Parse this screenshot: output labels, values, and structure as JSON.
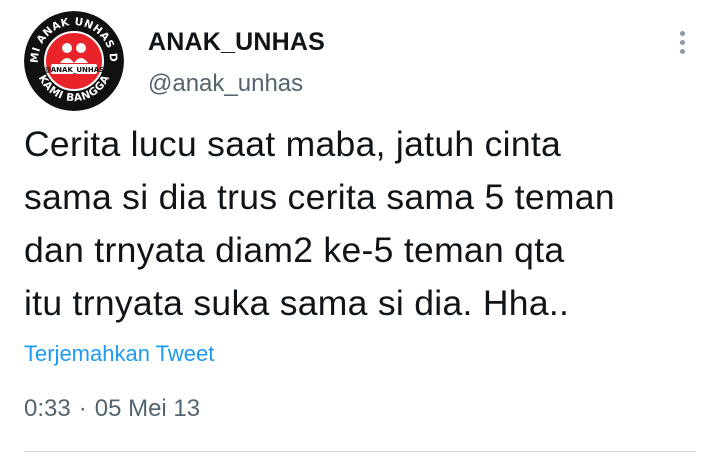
{
  "account": {
    "display_name": "ANAK_UNHAS",
    "handle": "@anak_unhas",
    "avatar_ring_text": "KAMI ANAK UNHAS DAN KAMI BANGGA",
    "avatar_badge_text": "@ANAK_UNHAS",
    "colors": {
      "avatar_ring": "#111111",
      "avatar_center": "#e8232a"
    }
  },
  "more_icon": "more-vertical-icon",
  "tweet": {
    "lines": [
      "Cerita lucu saat maba, jatuh cinta",
      "sama si dia trus cerita sama 5 teman",
      "dan trnyata diam2 ke-5 teman qta",
      "itu trnyata suka sama si dia. Hha.."
    ],
    "translate_label": "Terjemahkan Tweet",
    "time": "0:33",
    "separator": "·",
    "date": "05 Mei 13"
  },
  "colors": {
    "text_primary": "#0f1419",
    "text_secondary": "#536471",
    "link": "#1d9bf0",
    "divider": "#cfd9de"
  }
}
